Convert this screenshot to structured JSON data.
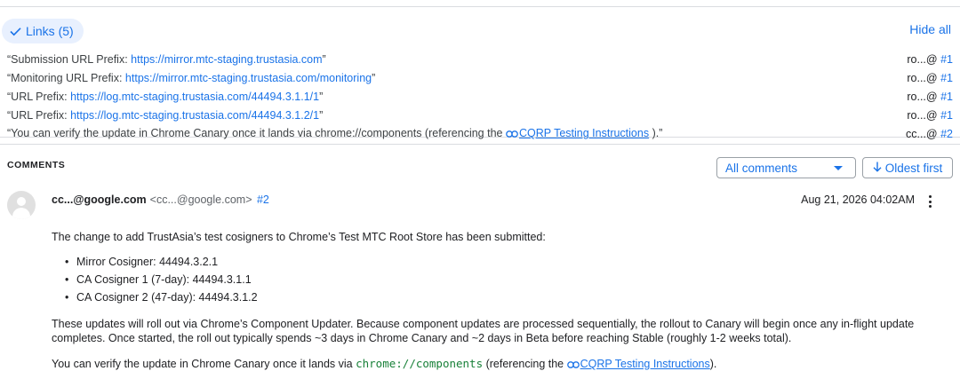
{
  "colors": {
    "accent": "#1a73e8",
    "code": "#188038",
    "chip_bg": "#e8f0fe"
  },
  "links": {
    "chip_label": "Links (5)",
    "hide_all": "Hide all",
    "items": [
      {
        "prefix": "“Submission URL Prefix: ",
        "url": "https://mirror.mtc-staging.trustasia.com",
        "suffix": "”",
        "user": "ro...@",
        "ref": "#1"
      },
      {
        "prefix": "“Monitoring URL Prefix: ",
        "url": "https://mirror.mtc-staging.trustasia.com/monitoring",
        "suffix": "”",
        "user": "ro...@",
        "ref": "#1"
      },
      {
        "prefix": "“URL Prefix: ",
        "url": "https://log.mtc-staging.trustasia.com/44494.3.1.1/1",
        "suffix": "”",
        "user": "ro...@",
        "ref": "#1"
      },
      {
        "prefix": "“URL Prefix: ",
        "url": "https://log.mtc-staging.trustasia.com/44494.3.1.2/1",
        "suffix": "”",
        "user": "ro...@",
        "ref": "#1"
      },
      {
        "prefix": "“You can verify the update in Chrome Canary once it lands via chrome://components (referencing the ",
        "url": "CQRP Testing Instructions",
        "suffix": " ).”",
        "user": "cc...@",
        "ref": "#2"
      }
    ]
  },
  "comments": {
    "title": "COMMENTS",
    "filter_value": "All comments",
    "sort_label": "Oldest first",
    "items": [
      {
        "author": "cc...@google.com",
        "email": "<cc...@google.com>",
        "number": "#2",
        "timestamp": "Aug 21, 2026 04:02AM",
        "p1": "The change to add TrustAsia’s test cosigners to Chrome’s Test MTC Root Store has been submitted:",
        "bullets": [
          "Mirror Cosigner: 44494.3.2.1",
          "CA Cosigner 1 (7-day): 44494.3.1.1",
          "CA Cosigner 2 (47-day): 44494.3.1.2"
        ],
        "p2": "These updates will roll out via Chrome’s Component Updater. Because component updates are processed sequentially, the rollout to Canary will begin once any in-flight update completes. Once started, the roll out typically spends ~3 days in Chrome Canary and ~2 days in Beta before reaching Stable (roughly 1-2 weeks total).",
        "p3_before": "You can verify the update in Chrome Canary once it lands via ",
        "p3_code": "chrome://components",
        "p3_mid": " (referencing the ",
        "p3_link": "CQRP Testing Instructions",
        "p3_after": ")."
      }
    ]
  }
}
